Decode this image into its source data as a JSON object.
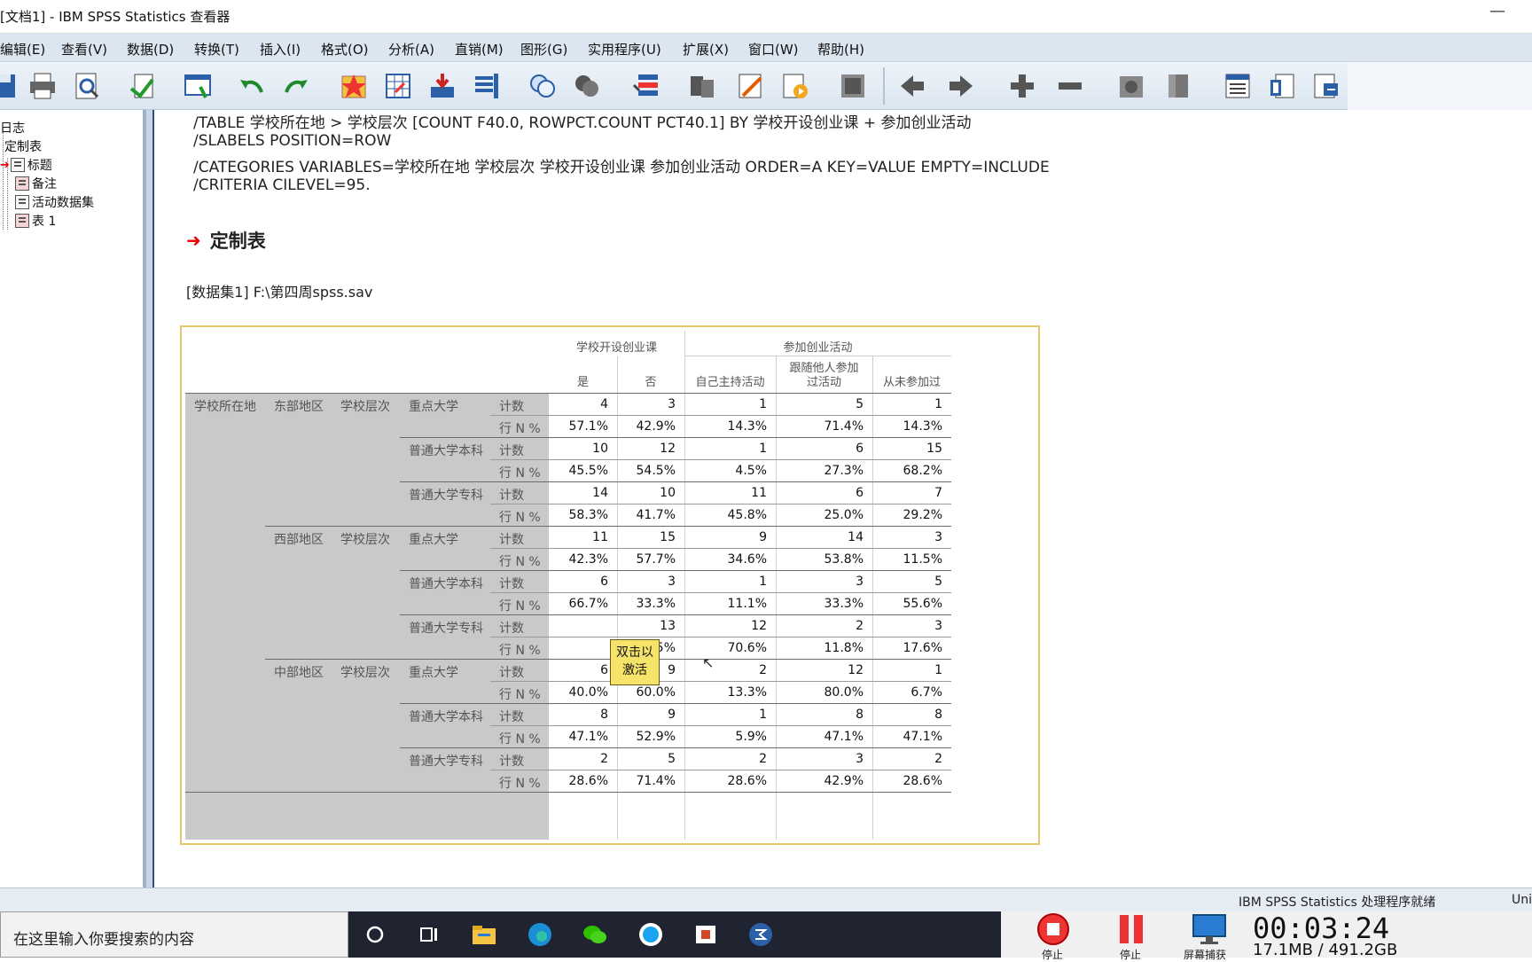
{
  "window": {
    "title": "[文档1] - IBM SPSS Statistics 查看器"
  },
  "menu": [
    "编辑(E)",
    "查看(V)",
    "数据(D)",
    "转换(T)",
    "插入(I)",
    "格式(O)",
    "分析(A)",
    "直销(M)",
    "图形(G)",
    "实用程序(U)",
    "扩展(X)",
    "窗口(W)",
    "帮助(H)"
  ],
  "outline": {
    "items": [
      "日志",
      "定制表",
      "标题",
      "备注",
      "活动数据集",
      "表 1"
    ]
  },
  "syntax": [
    "/TABLE 学校所在地 > 学校层次 [COUNT F40.0, ROWPCT.COUNT PCT40.1] BY 学校开设创业课 + 参加创业活动",
    "/SLABELS POSITION=ROW",
    "/CATEGORIES VARIABLES=学校所在地 学校层次 学校开设创业课 参加创业活动 ORDER=A KEY=VALUE EMPTY=INCLUDE",
    "/CRITERIA CILEVEL=95."
  ],
  "section_title": "定制表",
  "dataset_label": "[数据集1] F:\\第四周spss.sav",
  "table": {
    "group_headers": [
      "学校开设创业课",
      "参加创业活动"
    ],
    "col_headers": [
      "是",
      "否",
      "自己主持活动",
      "跟随他人参加过活动",
      "从未参加过"
    ],
    "col_header_lines": [
      [
        "是"
      ],
      [
        "否"
      ],
      [
        "自己主持活动"
      ],
      [
        "跟随他人参加",
        "过活动"
      ],
      [
        "从未参加过"
      ]
    ],
    "var1": "学校所在地",
    "var2": "学校层次",
    "regions": [
      "东部地区",
      "西部地区",
      "中部地区"
    ],
    "levels": [
      "重点大学",
      "普通大学本科",
      "普通大学专科"
    ],
    "stats": [
      "计数",
      "行 N %"
    ],
    "rows": [
      [
        "4",
        "3",
        "1",
        "5",
        "1"
      ],
      [
        "57.1%",
        "42.9%",
        "14.3%",
        "71.4%",
        "14.3%"
      ],
      [
        "10",
        "12",
        "1",
        "6",
        "15"
      ],
      [
        "45.5%",
        "54.5%",
        "4.5%",
        "27.3%",
        "68.2%"
      ],
      [
        "14",
        "10",
        "11",
        "6",
        "7"
      ],
      [
        "58.3%",
        "41.7%",
        "45.8%",
        "25.0%",
        "29.2%"
      ],
      [
        "11",
        "15",
        "9",
        "14",
        "3"
      ],
      [
        "42.3%",
        "57.7%",
        "34.6%",
        "53.8%",
        "11.5%"
      ],
      [
        "6",
        "3",
        "1",
        "3",
        "5"
      ],
      [
        "66.7%",
        "33.3%",
        "11.1%",
        "33.3%",
        "55.6%"
      ],
      [
        "",
        "13",
        "12",
        "2",
        "3"
      ],
      [
        "",
        "76.5%",
        "70.6%",
        "11.8%",
        "17.6%"
      ],
      [
        "6",
        "9",
        "2",
        "12",
        "1"
      ],
      [
        "40.0%",
        "60.0%",
        "13.3%",
        "80.0%",
        "6.7%"
      ],
      [
        "8",
        "9",
        "1",
        "8",
        "8"
      ],
      [
        "47.1%",
        "52.9%",
        "5.9%",
        "47.1%",
        "47.1%"
      ],
      [
        "2",
        "5",
        "2",
        "3",
        "2"
      ],
      [
        "28.6%",
        "71.4%",
        "28.6%",
        "42.9%",
        "28.6%"
      ]
    ]
  },
  "tooltip": "双击以激活",
  "status": {
    "ready": "IBM SPSS Statistics 处理程序就绪",
    "right": "Uni"
  },
  "taskbar": {
    "search_placeholder": "在这里输入你要搜索的内容",
    "rec_stop": "停止",
    "rec_pause": "停止",
    "rec_capture": "屏幕捕获",
    "timer": "00:03:24",
    "memory": "17.1MB / 491.2GB"
  }
}
